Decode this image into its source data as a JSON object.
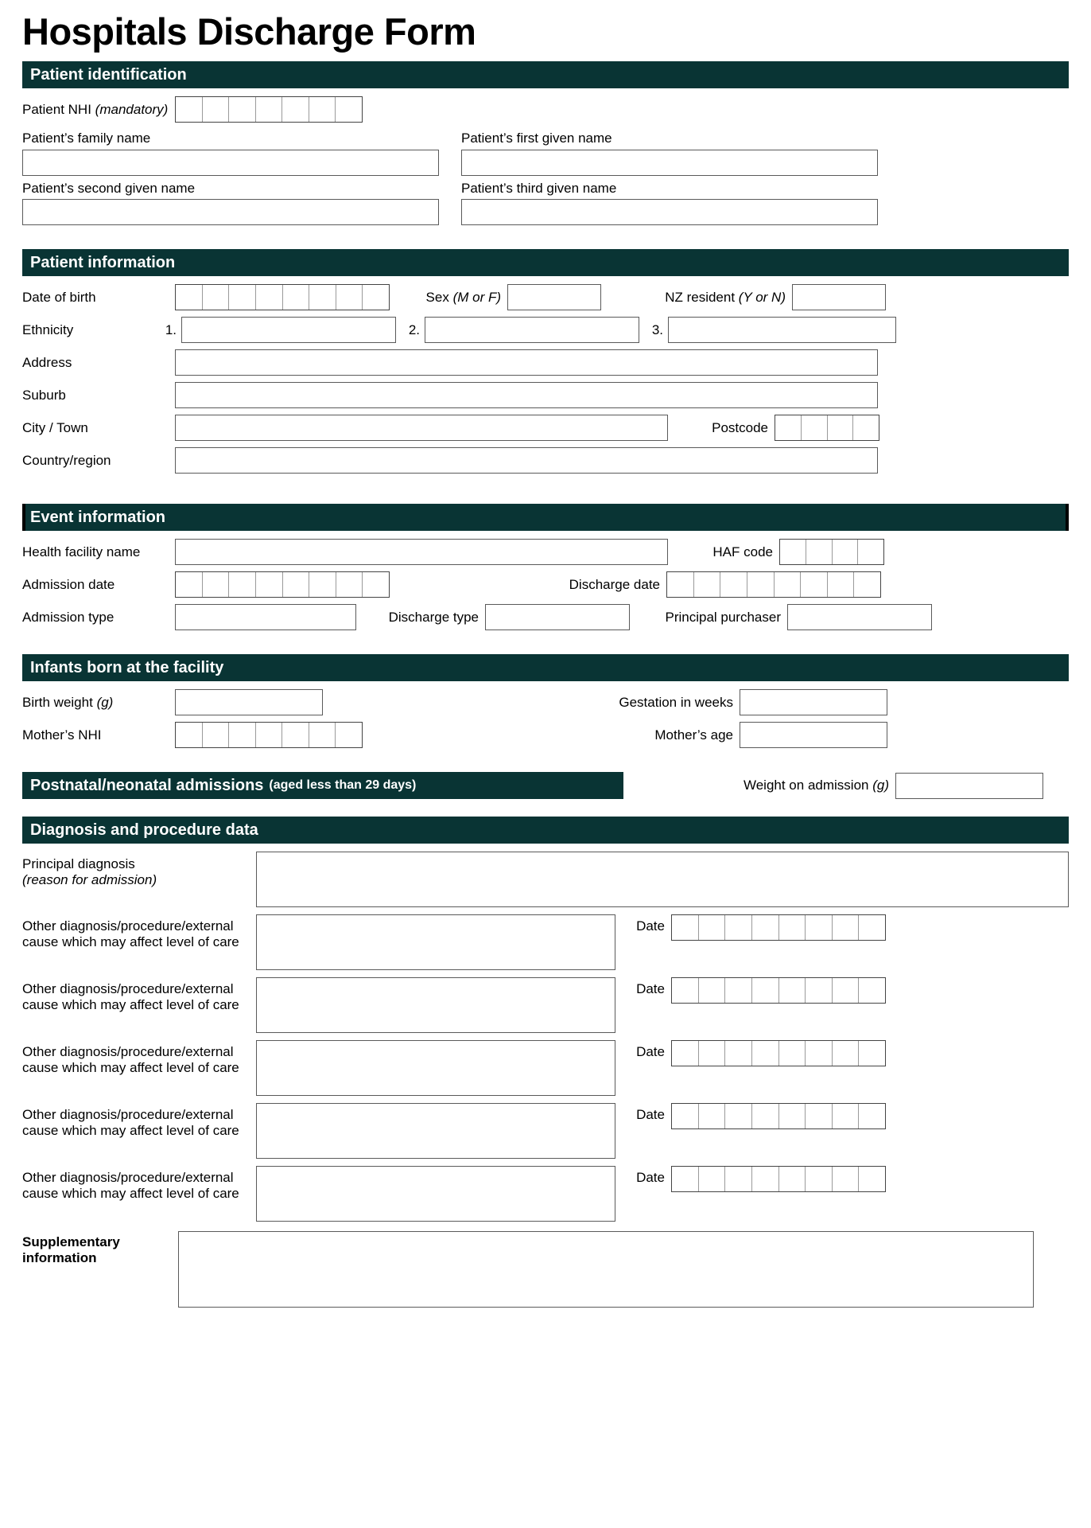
{
  "document": {
    "title": "Hospitals Discharge Form",
    "accent_color": "#093434",
    "border_color": "#5a5a5a"
  },
  "sections": {
    "patient_identification": {
      "heading": "Patient identification",
      "fields": {
        "nhi_label": "Patient NHI",
        "nhi_note": "(mandatory)",
        "nhi_cells": 7,
        "family_name": "Patient’s family name",
        "first_given_name": "Patient’s first given name",
        "second_given_name": "Patient’s second given name",
        "third_given_name": "Patient’s third given name"
      }
    },
    "patient_information": {
      "heading": "Patient information",
      "fields": {
        "date_of_birth": "Date of birth",
        "date_of_birth_cells": 8,
        "sex": "Sex",
        "sex_note": "(M or F)",
        "nz_resident": "NZ resident",
        "nz_resident_note": "(Y or N)",
        "ethnicity": "Ethnicity",
        "ethnicity_1": "1.",
        "ethnicity_2": "2.",
        "ethnicity_3": "3.",
        "address": "Address",
        "suburb": "Suburb",
        "city_town": "City / Town",
        "postcode": "Postcode",
        "postcode_cells": 4,
        "country_region": "Country/region"
      }
    },
    "event_information": {
      "heading": "Event information",
      "fields": {
        "health_facility_name": "Health facility name",
        "haf_code": "HAF code",
        "haf_code_cells": 4,
        "admission_date": "Admission date",
        "admission_date_cells": 8,
        "discharge_date": "Discharge date",
        "discharge_date_cells": 8,
        "admission_type": "Admission type",
        "discharge_type": "Discharge type",
        "principal_purchaser": "Principal purchaser"
      }
    },
    "infants": {
      "heading": "Infants born at the facility",
      "fields": {
        "birth_weight": "Birth weight",
        "birth_weight_note": "(g)",
        "gestation_in_weeks": "Gestation in weeks",
        "mothers_nhi": "Mother’s NHI",
        "mothers_nhi_cells": 7,
        "mothers_age": "Mother’s age"
      }
    },
    "postnatal": {
      "heading": "Postnatal/neonatal admissions",
      "heading_note": "(aged less than 29 days)",
      "fields": {
        "weight_on_admission": "Weight on admission",
        "weight_on_admission_note": "(g)"
      }
    },
    "diagnosis": {
      "heading": "Diagnosis and procedure data",
      "principal_diagnosis_line1": "Principal diagnosis",
      "principal_diagnosis_line2": "(reason for admission)",
      "other_rows": [
        {
          "line1": "Other diagnosis/procedure/external",
          "line2": "cause which may affect level of care",
          "date_label": "Date",
          "date_cells": 8
        },
        {
          "line1": "Other diagnosis/procedure/external",
          "line2": "cause which may affect level of care",
          "date_label": "Date",
          "date_cells": 8
        },
        {
          "line1": "Other diagnosis/procedure/external",
          "line2": "cause which may affect level of care",
          "date_label": "Date",
          "date_cells": 8
        },
        {
          "line1": "Other diagnosis/procedure/external",
          "line2": "cause which may affect level of care",
          "date_label": "Date",
          "date_cells": 8
        },
        {
          "line1": "Other diagnosis/procedure/external",
          "line2": "cause which may affect level of care",
          "date_label": "Date",
          "date_cells": 8
        }
      ],
      "supplementary_line1": "Supplementary",
      "supplementary_line2": "information"
    }
  }
}
